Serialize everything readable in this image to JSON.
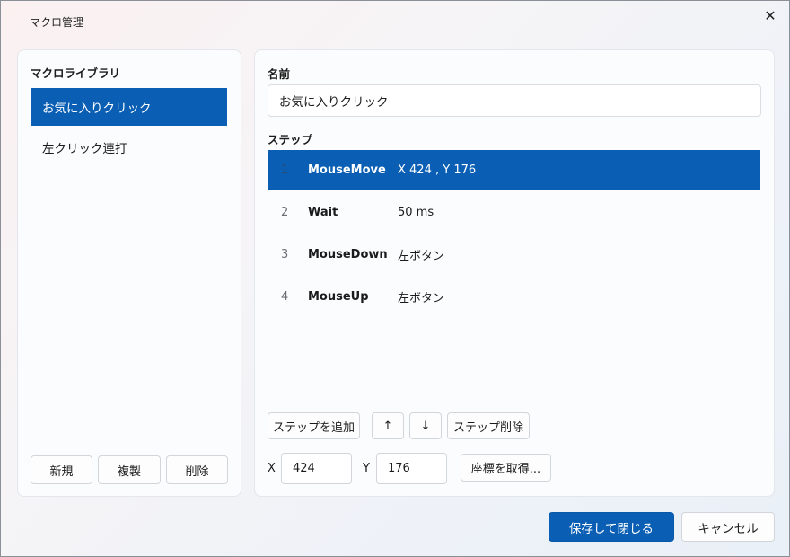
{
  "window": {
    "title": "マクロ管理",
    "close_glyph": "✕"
  },
  "library": {
    "heading": "マクロライブラリ",
    "items": [
      {
        "label": "お気に入りクリック",
        "selected": true
      },
      {
        "label": "左クリック連打",
        "selected": false
      }
    ],
    "buttons": {
      "new": "新規",
      "duplicate": "複製",
      "delete": "削除"
    }
  },
  "editor": {
    "name_label": "名前",
    "name_value": "お気に入りクリック",
    "steps_label": "ステップ",
    "steps": [
      {
        "num": "1",
        "command": "MouseMove",
        "param": "X 424 , Y 176",
        "selected": true
      },
      {
        "num": "2",
        "command": "Wait",
        "param": "50 ms",
        "selected": false
      },
      {
        "num": "3",
        "command": "MouseDown",
        "param": "左ボタン",
        "selected": false
      },
      {
        "num": "4",
        "command": "MouseUp",
        "param": "左ボタン",
        "selected": false
      }
    ],
    "buttons": {
      "add_step": "ステップを追加",
      "move_up": "↑",
      "move_down": "↓",
      "delete_step": "ステップ削除"
    },
    "coords": {
      "x_label": "X",
      "x_value": "424",
      "y_label": "Y",
      "y_value": "176",
      "capture": "座標を取得..."
    }
  },
  "footer": {
    "save_close": "保存して閉じる",
    "cancel": "キャンセル"
  },
  "colors": {
    "accent": "#0a5fb4",
    "background_from": "#fbf1f1",
    "background_to": "#eaf0f7"
  }
}
